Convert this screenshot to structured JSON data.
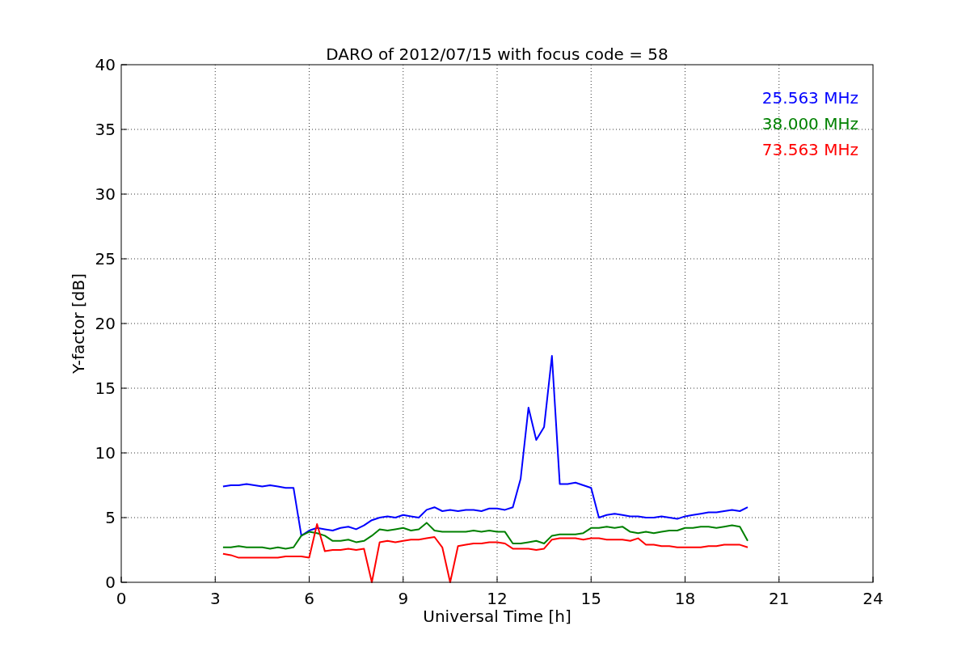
{
  "figure": {
    "chart_data": {
      "type": "line",
      "title": "DARO of 2012/07/15 with focus code = 58",
      "xlabel": "Universal Time [h]",
      "ylabel": "Y-factor [dB]",
      "xlim": [
        0,
        24
      ],
      "ylim": [
        0,
        40
      ],
      "grid": true,
      "xticks": [
        0,
        3,
        6,
        9,
        12,
        15,
        18,
        21,
        24
      ],
      "yticks": [
        0,
        5,
        10,
        15,
        20,
        25,
        30,
        35,
        40
      ],
      "x": [
        3.25,
        3.5,
        3.75,
        4,
        4.25,
        4.5,
        4.75,
        5,
        5.25,
        5.5,
        5.75,
        6,
        6.25,
        6.5,
        6.75,
        7,
        7.25,
        7.5,
        7.75,
        8,
        8.25,
        8.5,
        8.75,
        9,
        9.25,
        9.5,
        9.75,
        10,
        10.25,
        10.5,
        10.75,
        11,
        11.25,
        11.5,
        11.75,
        12,
        12.25,
        12.5,
        12.75,
        13,
        13.25,
        13.5,
        13.75,
        14,
        14.25,
        14.5,
        14.75,
        15,
        15.25,
        15.5,
        15.75,
        16,
        16.25,
        16.5,
        16.75,
        17,
        17.25,
        17.5,
        17.75,
        18,
        18.25,
        18.5,
        18.75,
        19,
        19.25,
        19.5,
        19.75,
        20
      ],
      "series": [
        {
          "name": "25.563 MHz",
          "color": "#0000ff",
          "values": [
            7.4,
            7.5,
            7.5,
            7.6,
            7.5,
            7.4,
            7.5,
            7.4,
            7.3,
            7.3,
            3.6,
            4.0,
            4.2,
            4.1,
            4.0,
            4.2,
            4.3,
            4.1,
            4.4,
            4.8,
            5.0,
            5.1,
            5.0,
            5.2,
            5.1,
            5.0,
            5.6,
            5.8,
            5.5,
            5.6,
            5.5,
            5.6,
            5.6,
            5.5,
            5.7,
            5.7,
            5.6,
            5.8,
            8.0,
            13.5,
            11.0,
            12.0,
            17.5,
            7.6,
            7.6,
            7.7,
            7.5,
            7.3,
            5.0,
            5.2,
            5.3,
            5.2,
            5.1,
            5.1,
            5.0,
            5.0,
            5.1,
            5.0,
            4.9,
            5.1,
            5.2,
            5.3,
            5.4,
            5.4,
            5.5,
            5.6,
            5.5,
            5.8
          ]
        },
        {
          "name": "38.000 MHz",
          "color": "#008000",
          "values": [
            2.7,
            2.7,
            2.8,
            2.7,
            2.7,
            2.7,
            2.6,
            2.7,
            2.6,
            2.7,
            3.6,
            3.9,
            3.8,
            3.6,
            3.2,
            3.2,
            3.3,
            3.1,
            3.2,
            3.6,
            4.1,
            4.0,
            4.1,
            4.2,
            4.0,
            4.1,
            4.6,
            4.0,
            3.9,
            3.9,
            3.9,
            3.9,
            4.0,
            3.9,
            4.0,
            3.9,
            3.9,
            3.0,
            3.0,
            3.1,
            3.2,
            3.0,
            3.6,
            3.7,
            3.7,
            3.7,
            3.8,
            4.2,
            4.2,
            4.3,
            4.2,
            4.3,
            3.9,
            3.8,
            3.9,
            3.8,
            3.9,
            4.0,
            4.0,
            4.2,
            4.2,
            4.3,
            4.3,
            4.2,
            4.3,
            4.4,
            4.3,
            3.2
          ]
        },
        {
          "name": "73.563 MHz",
          "color": "#ff0000",
          "values": [
            2.2,
            2.1,
            1.9,
            1.9,
            1.9,
            1.9,
            1.9,
            1.9,
            2.0,
            2.0,
            2.0,
            1.9,
            4.5,
            2.4,
            2.5,
            2.5,
            2.6,
            2.5,
            2.6,
            0,
            3.1,
            3.2,
            3.1,
            3.2,
            3.3,
            3.3,
            3.4,
            3.5,
            2.7,
            0,
            2.8,
            2.9,
            3.0,
            3.0,
            3.1,
            3.1,
            3.0,
            2.6,
            2.6,
            2.6,
            2.5,
            2.6,
            3.3,
            3.4,
            3.4,
            3.4,
            3.3,
            3.4,
            3.4,
            3.3,
            3.3,
            3.3,
            3.2,
            3.4,
            2.9,
            2.9,
            2.8,
            2.8,
            2.7,
            2.7,
            2.7,
            2.7,
            2.8,
            2.8,
            2.9,
            2.9,
            2.9,
            2.7
          ]
        }
      ]
    }
  }
}
